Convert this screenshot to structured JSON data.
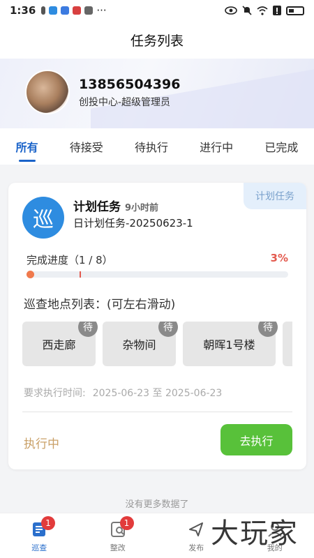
{
  "status_bar": {
    "time": "1:36",
    "more": "···"
  },
  "header": {
    "title": "任务列表"
  },
  "profile": {
    "phone": "13856504396",
    "role": "创投中心-超级管理员"
  },
  "tabs": [
    {
      "label": "所有",
      "active": true
    },
    {
      "label": "待接受",
      "active": false
    },
    {
      "label": "待执行",
      "active": false
    },
    {
      "label": "进行中",
      "active": false
    },
    {
      "label": "已完成",
      "active": false
    }
  ],
  "task": {
    "tag": "计划任务",
    "icon_char": "巡",
    "title": "计划任务",
    "time_ago": "9小时前",
    "code": "日计划任务-20250623-1",
    "progress_label": "完成进度（1 / 8）",
    "progress_pct": "3%",
    "progress_value": 0.03,
    "locations_label": "巡查地点列表：(可左右滑动)",
    "locations": [
      {
        "name": "西走廊",
        "badge": "待"
      },
      {
        "name": "杂物间",
        "badge": "待"
      },
      {
        "name": "朝晖1号楼",
        "badge": "待"
      }
    ],
    "required_time_label": "要求执行时间:",
    "required_time_value": "2025-06-23 至 2025-06-23",
    "status": "执行中",
    "action_button": "去执行"
  },
  "footer": {
    "no_more": "没有更多数据了"
  },
  "bottom_nav": [
    {
      "label": "巡查",
      "icon": "patrol-icon",
      "badge": "1",
      "active": true
    },
    {
      "label": "整改",
      "icon": "rectify-icon",
      "badge": "1",
      "active": false
    },
    {
      "label": "发布",
      "icon": "publish-icon",
      "badge": "",
      "active": false
    },
    {
      "label": "我的",
      "icon": "profile-icon",
      "badge": "",
      "active": false
    }
  ],
  "watermark": "大玩家",
  "colors": {
    "accent": "#1a63c9",
    "exec_button": "#58c13a",
    "progress": "#f08a5d",
    "status": "#c9a067"
  }
}
